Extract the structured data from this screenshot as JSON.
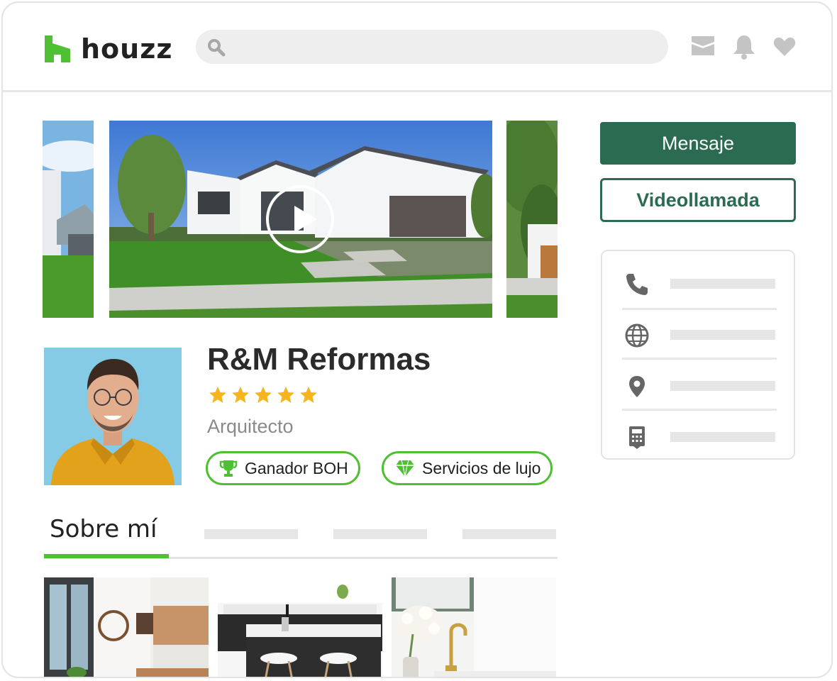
{
  "app": {
    "logo_text": "houzz",
    "brand_color": "#4fbf33",
    "search_placeholder": ""
  },
  "header_icons": [
    "mail-icon",
    "bell-icon",
    "heart-icon"
  ],
  "profile": {
    "name": "R&M Reformas",
    "rating": 5,
    "rating_max": 5,
    "profession": "Arquitecto",
    "badges": [
      {
        "label": "Ganador BOH",
        "icon": "trophy-icon"
      },
      {
        "label": "Servicios de lujo",
        "icon": "diamond-icon"
      }
    ]
  },
  "tabs": {
    "active": "Sobre mí"
  },
  "actions": {
    "message_label": "Mensaje",
    "video_call_label": "Videollamada",
    "primary_color": "#2b6b52"
  },
  "contact": {
    "rows": [
      {
        "icon": "phone-icon"
      },
      {
        "icon": "globe-icon"
      },
      {
        "icon": "location-pin-icon"
      },
      {
        "icon": "calculator-icon"
      }
    ]
  }
}
